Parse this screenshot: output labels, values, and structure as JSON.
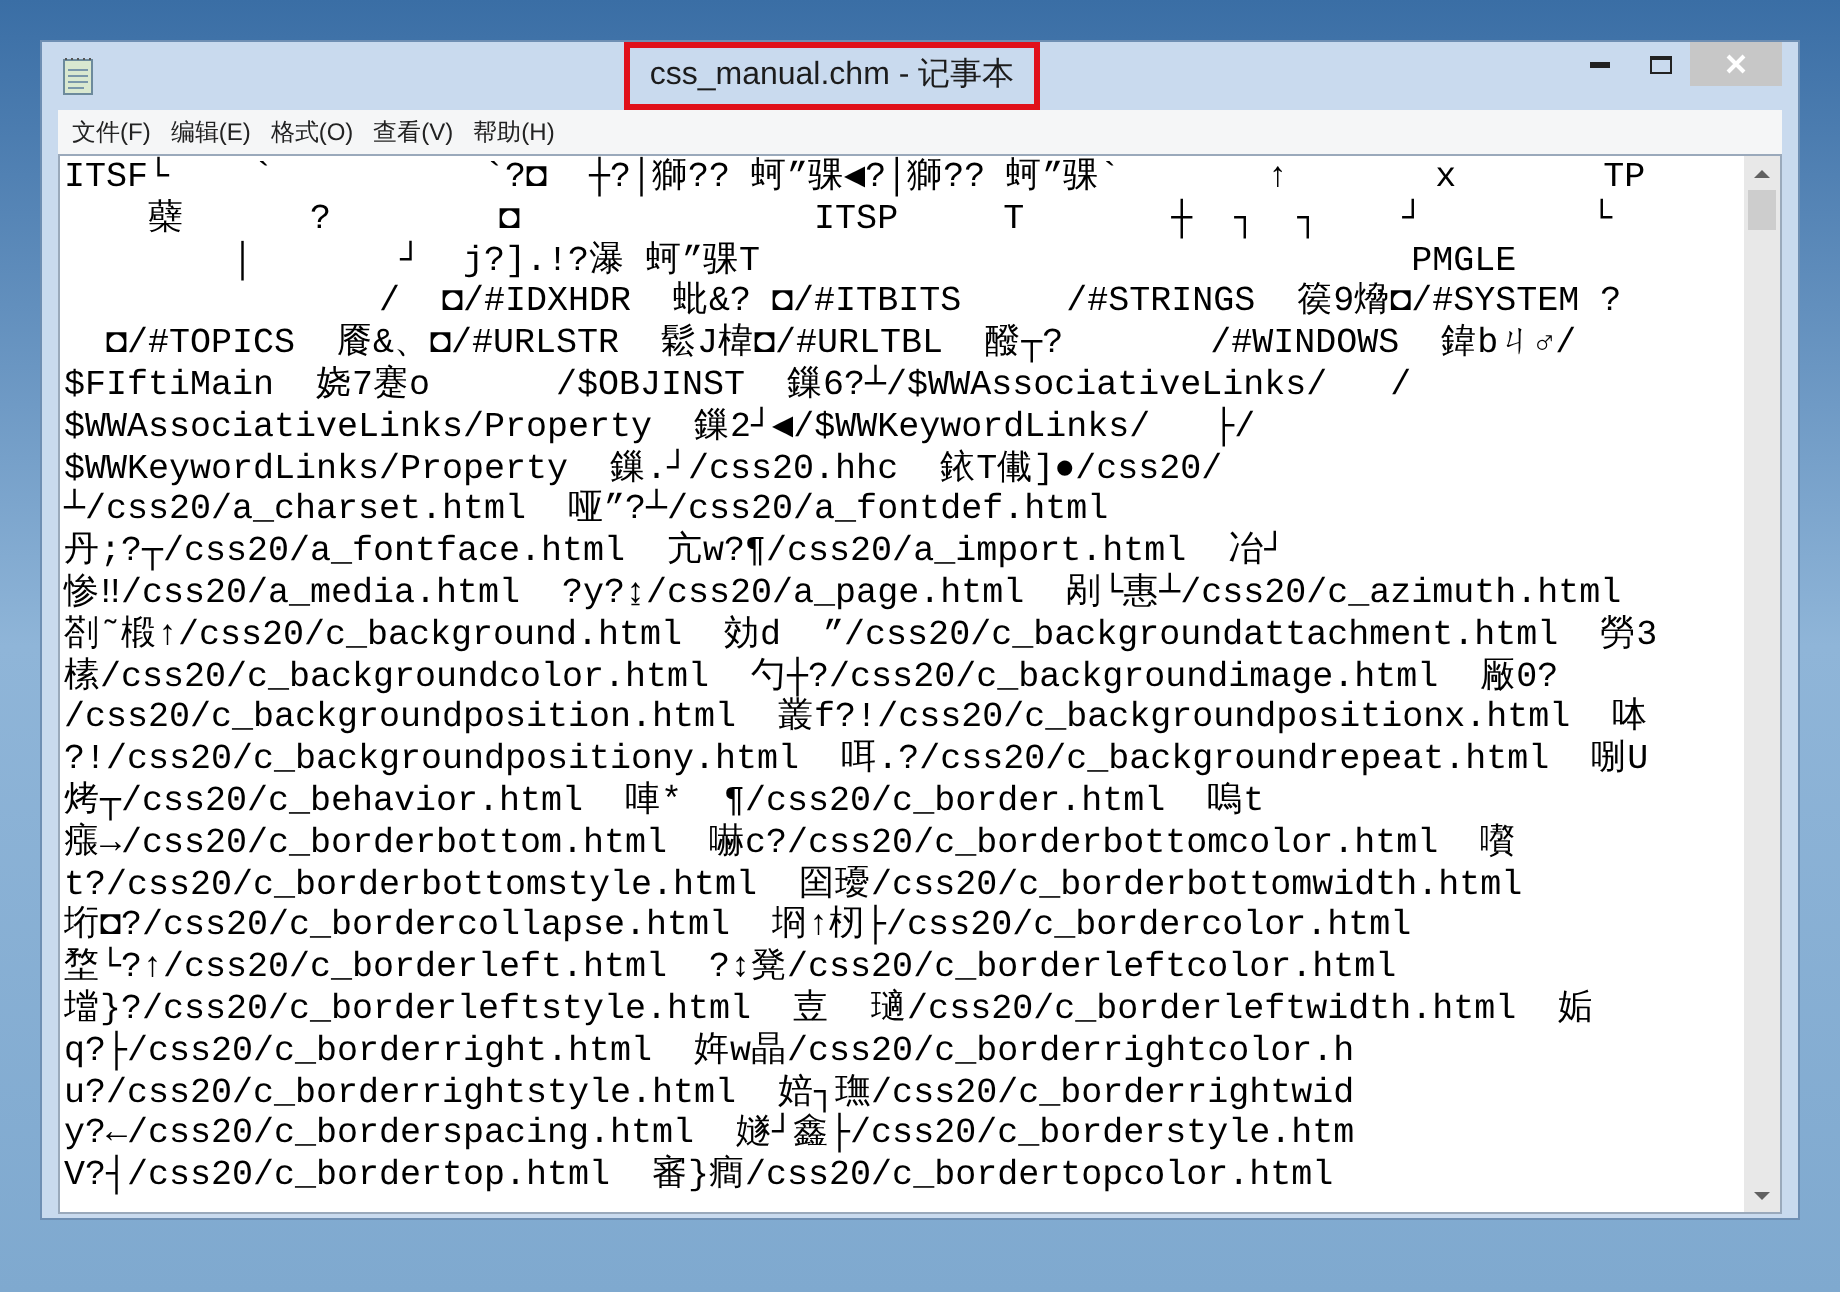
{
  "window": {
    "title": "css_manual.chm - 记事本",
    "title_highlighted": true
  },
  "menu": [
    "文件(F)",
    "编辑(E)",
    "格式(O)",
    "查看(V)",
    "帮助(H)"
  ],
  "lines": [
    "ITSF└    `          `?◘  ┼?│獅?? 蚵”骒◀?│獅?? 蚵”骒`       ↑       x       TP",
    "    蘗      ?        ◘              ITSP     T       ┼  ┐  ┐    ┘        └",
    "        │       ┘  j?].!?瀑 蚵”骒T                               PMGLE",
    "               /  ◘/#IDXHDR  蚍&? ◘/#ITBITS     /#STRINGS  篌9熁◘/#SYSTEM ?",
    "  ◘/#TOPICS  餍&、◘/#URLSTR  鬆J椲◘/#URLTBL  醱┬?       /#WINDOWS  鍏bㄐ♂/",
    "$FIftiMain  娆7蹇o      /$OBJINST  鏁6?┴/$WWAssociativeLinks/   /",
    "$WWAssociativeLinks/Property  鏁2┘◀/$WWKeywordLinks/   ├/",
    "$WWKeywordLinks/Property  鏁.┘/css20.hhc  銥T儎]●/css20/",
    "┴/css20/a_charset.html  哑”?┴/css20/a_fontdef.html",
    "丹;?┬/css20/a_fontface.html  亢w?¶/css20/a_import.html  冶┘",
    "惨‼/css20/a_media.html  ?y?↨/css20/a_page.html  剐└惠┴/css20/c_azimuth.html",
    "剳˜椴↑/css20/c_background.html  効d  ”/css20/c_backgroundattachment.html  勞3",
    "榡/css20/c_backgroundcolor.html  勺┼?/css20/c_backgroundimage.html  厰0?",
    "/css20/c_backgroundposition.html  叢f?!/css20/c_backgroundpositionx.html  呠",
    "?!/css20/c_backgroundpositiony.html  咡.?/css20/c_backgroundrepeat.html  哵U",
    "烤┬/css20/c_behavior.html  唓*  ¶/css20/c_border.html  嗚t",
    "瘬→/css20/c_borderbottom.html  嚇c?/css20/c_borderbottomcolor.html  嚽",
    "t?/css20/c_borderbottomstyle.html  囶瓇/css20/c_borderbottomwidth.html",
    "垳◘?/css20/c_bordercollapse.html  埛↑杒├/css20/c_bordercolor.html",
    "堥└?↑/css20/c_borderleft.html  ?↕凳/css20/c_borderleftcolor.html",
    "壋}?/css20/c_borderleftstyle.html  壴  瓋/css20/c_borderleftwidth.html  姤",
    "q?├/css20/c_borderright.html  姩w晶/css20/c_borderrightcolor.h",
    "u?/css20/c_borderrightstyle.html  婄┐璑/css20/c_borderrightwid",
    "y?←/css20/c_borderspacing.html  嬘┘鑫├/css20/c_borderstyle.htm",
    "V?┤/css20/c_bordertop.html  審}癎/css20/c_bordertopcolor.html"
  ]
}
